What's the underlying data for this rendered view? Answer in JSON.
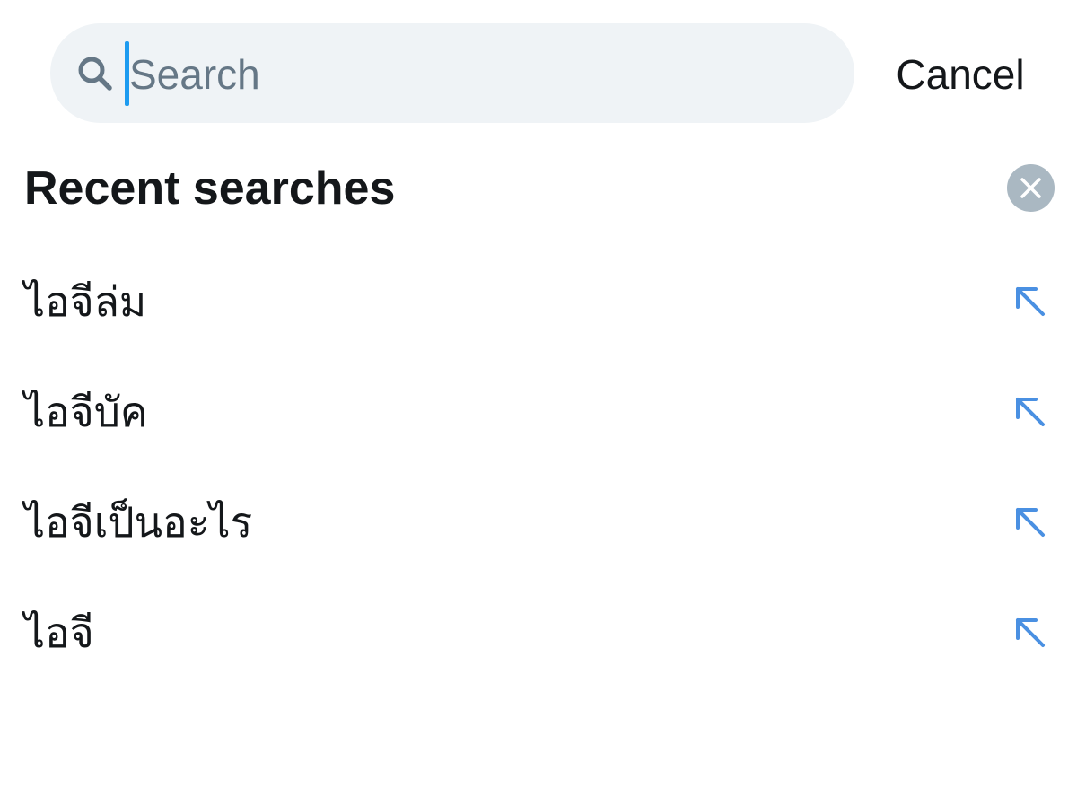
{
  "search": {
    "placeholder": "Search",
    "value": ""
  },
  "header": {
    "cancel_label": "Cancel"
  },
  "recent": {
    "title": "Recent searches",
    "items": [
      {
        "label": "ไอจีล่ม"
      },
      {
        "label": "ไอจีบัค"
      },
      {
        "label": "ไอจีเป็นอะไร"
      },
      {
        "label": "ไอจี"
      }
    ]
  },
  "icons": {
    "search": "search-icon",
    "clear": "close-icon",
    "fill": "arrow-up-left-icon"
  },
  "colors": {
    "accent": "#1d9bf0",
    "search_bg": "#eff3f6",
    "placeholder": "#657786",
    "clear_bg": "#aab8c2",
    "text": "#14171a"
  }
}
